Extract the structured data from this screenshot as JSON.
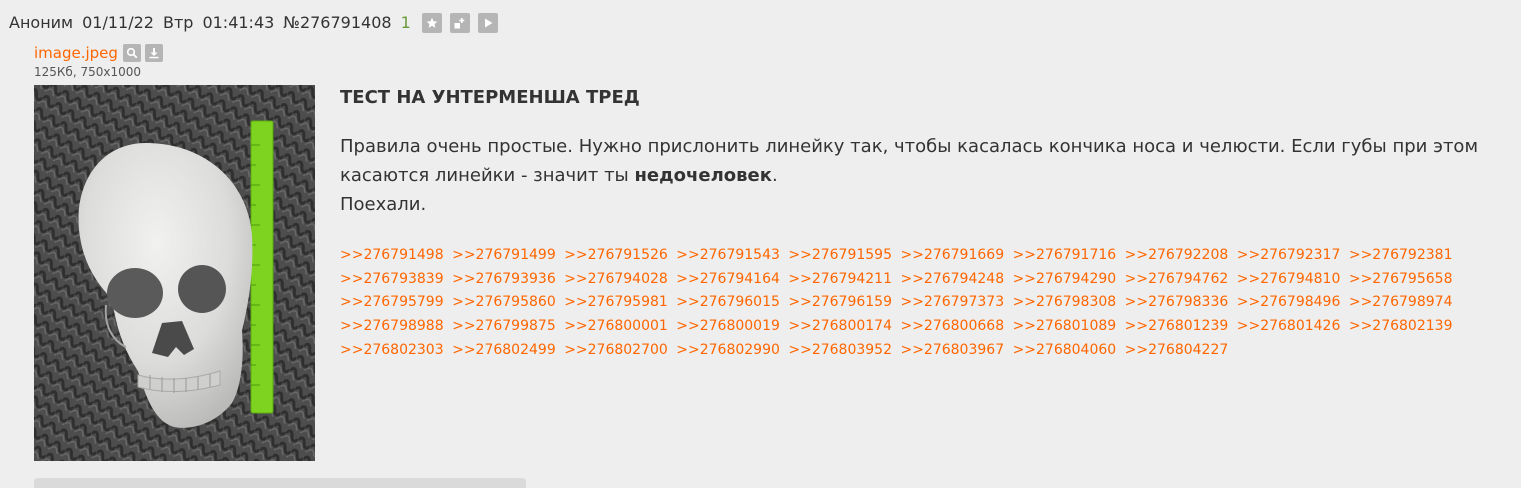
{
  "header": {
    "author": "Аноним",
    "date": "01/11/22",
    "weekday": "Втр",
    "time": "01:41:43",
    "post_number": "№276791408",
    "reply_count": "1",
    "icons": [
      "star-icon",
      "expand-icon",
      "play-icon"
    ]
  },
  "file": {
    "name": "image.jpeg",
    "meta": "125Кб, 750x1000",
    "icons": [
      "search-icon",
      "download-icon"
    ]
  },
  "post": {
    "subject": "ТЕСТ НА УНТЕРМЕНША ТРЕД",
    "line1": "Правила очень простые. Нужно прислонить линейку так, чтобы касалась кончика носа и челюсти. Если губы при этом касаются линейки - значит ты ",
    "line1_bold": "недочеловек",
    "line1_end": ".",
    "line2": "Поехали."
  },
  "replies": [
    ">>276791498",
    ">>276791499",
    ">>276791526",
    ">>276791543",
    ">>276791595",
    ">>276791669",
    ">>276791716",
    ">>276792208",
    ">>276792317",
    ">>276792381",
    ">>276793839",
    ">>276793936",
    ">>276794028",
    ">>276794164",
    ">>276794211",
    ">>276794248",
    ">>276794290",
    ">>276794762",
    ">>276794810",
    ">>276795658",
    ">>276795799",
    ">>276795860",
    ">>276795981",
    ">>276796015",
    ">>276796159",
    ">>276797373",
    ">>276798308",
    ">>276798336",
    ">>276798496",
    ">>276798974",
    ">>276798988",
    ">>276799875",
    ">>276800001",
    ">>276800019",
    ">>276800174",
    ">>276800668",
    ">>276801089",
    ">>276801239",
    ">>276801426",
    ">>276802139",
    ">>276802303",
    ">>276802499",
    ">>276802700",
    ">>276802990",
    ">>276803952",
    ">>276803967",
    ">>276804060",
    ">>276804227"
  ],
  "colors": {
    "accent": "#ff6600",
    "reply_count": "#6a9b3a",
    "text": "#333333",
    "background": "#eeeeee"
  }
}
